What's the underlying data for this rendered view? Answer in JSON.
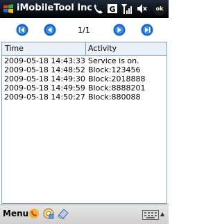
{
  "titlebar": {
    "title": "iMobileTool Incon",
    "ok_label": "ok"
  },
  "nav": {
    "page_indicator": "1/1"
  },
  "grid": {
    "headers": [
      "Time",
      "Activity"
    ],
    "rows": [
      {
        "time": "2009-05-18 14:43:33",
        "activity": "Service is on."
      },
      {
        "time": "2009-05-18 14:48:52",
        "activity": "Block:123456"
      },
      {
        "time": "2009-05-18 14:49:30",
        "activity": "Block:2018888"
      },
      {
        "time": "2009-05-18 14:49:59",
        "activity": "Block:8888201"
      },
      {
        "time": "2009-05-18 14:50:27",
        "activity": "Block:880088"
      }
    ]
  },
  "bottombar": {
    "menu_label": "Menu"
  },
  "colors": {
    "accent": "#1565c0",
    "header_bg": "#eaf0f6",
    "border": "#7f9db9"
  }
}
